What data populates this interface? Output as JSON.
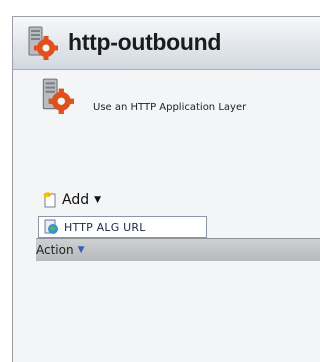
{
  "header": {
    "title": "http-outbound",
    "icon": "gear-server-icon"
  },
  "description": {
    "text": "Use an HTTP Application Layer",
    "icon": "gear-server-icon"
  },
  "toolbar": {
    "add_label": "Add",
    "add_icon": "new-document-icon",
    "caret": "▼"
  },
  "add_menu": {
    "items": [
      {
        "label": "HTTP ALG URL",
        "icon": "url-globe-icon"
      }
    ]
  },
  "table": {
    "columns": [
      {
        "label": "Action",
        "caret": "▼"
      }
    ]
  }
}
